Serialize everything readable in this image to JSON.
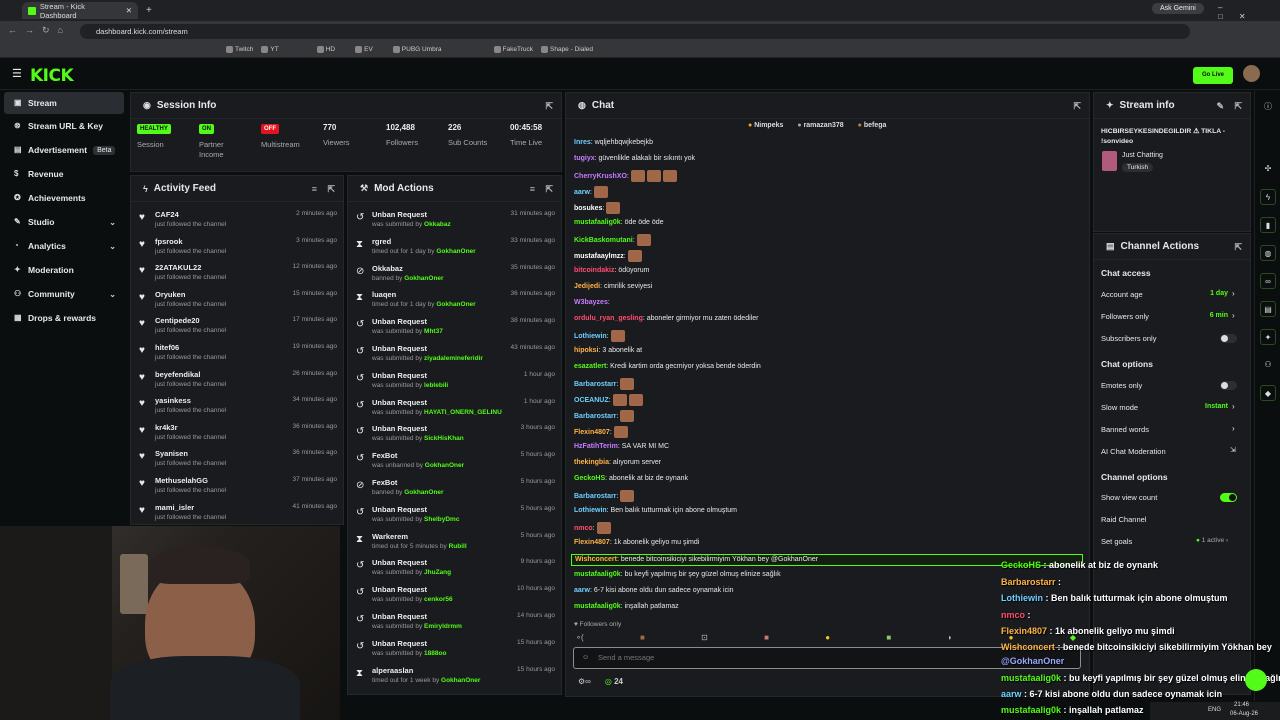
{
  "browser": {
    "tab_title": "Stream - Kick Dashboard",
    "url": "dashboard.kick.com/stream",
    "ask_gemini": "Ask Gemini",
    "bookmarks": [
      "Twitch",
      "YT",
      "HD",
      "EV",
      "PUBG Umbra",
      "FakeTruck",
      "Shape - Dialed"
    ]
  },
  "header": {
    "logo": "KICK",
    "go_live": "Go Live"
  },
  "sidebar": {
    "items": [
      {
        "label": "Stream",
        "icon": "video-icon"
      },
      {
        "label": "Stream URL & Key",
        "icon": "key-icon"
      },
      {
        "label": "Advertisement",
        "badge": "Beta",
        "icon": "megaphone-icon"
      },
      {
        "label": "Revenue",
        "icon": "dollar-icon"
      },
      {
        "label": "Achievements",
        "icon": "trophy-icon"
      },
      {
        "label": "Studio",
        "icon": "studio-icon"
      },
      {
        "label": "Analytics",
        "icon": "chart-icon"
      },
      {
        "label": "Moderation",
        "icon": "wrench-icon"
      },
      {
        "label": "Community",
        "icon": "people-icon"
      },
      {
        "label": "Drops & rewards",
        "icon": "gift-icon"
      }
    ]
  },
  "session": {
    "title": "Session Info",
    "stats": [
      {
        "value": "HEALTHY",
        "label": "Session",
        "kind": "badge-green"
      },
      {
        "value": "ON",
        "label": "Partner Income",
        "kind": "badge-green"
      },
      {
        "value": "OFF",
        "label": "Multistream",
        "kind": "badge-red"
      },
      {
        "value": "770",
        "label": "Viewers",
        "kind": "num"
      },
      {
        "value": "102,488",
        "label": "Followers",
        "kind": "num"
      },
      {
        "value": "226",
        "label": "Sub Counts",
        "kind": "num"
      },
      {
        "value": "00:45:58",
        "label": "Time Live",
        "kind": "num"
      }
    ]
  },
  "activity": {
    "title": "Activity Feed",
    "items": [
      {
        "name": "CAF24",
        "sub": "just followed the channel",
        "time": "2 minutes ago"
      },
      {
        "name": "fpsrook",
        "sub": "just followed the channel",
        "time": "3 minutes ago"
      },
      {
        "name": "22ATAKUL22",
        "sub": "just followed the channel",
        "time": "12 minutes ago"
      },
      {
        "name": "Oryuken",
        "sub": "just followed the channel",
        "time": "15 minutes ago"
      },
      {
        "name": "Centipede20",
        "sub": "just followed the channel",
        "time": "17 minutes ago"
      },
      {
        "name": "hitef06",
        "sub": "just followed the channel",
        "time": "19 minutes ago"
      },
      {
        "name": "beyefendikal",
        "sub": "just followed the channel",
        "time": "26 minutes ago"
      },
      {
        "name": "yasinkess",
        "sub": "just followed the channel",
        "time": "34 minutes ago"
      },
      {
        "name": "kr4k3r",
        "sub": "just followed the channel",
        "time": "36 minutes ago"
      },
      {
        "name": "Syanisen",
        "sub": "just followed the channel",
        "time": "36 minutes ago"
      },
      {
        "name": "MethuselahGG",
        "sub": "just followed the channel",
        "time": "37 minutes ago"
      },
      {
        "name": "mami_isler",
        "sub": "just followed the channel",
        "time": "41 minutes ago"
      }
    ]
  },
  "mod": {
    "title": "Mod Actions",
    "items": [
      {
        "name": "Unban Request",
        "sub": "was submitted by",
        "by": "Okkabaz",
        "time": "31 minutes ago",
        "icon": "undo-icon"
      },
      {
        "name": "rgred",
        "sub": "timed out for 1 day by",
        "by": "GokhanOner",
        "time": "33 minutes ago",
        "icon": "hourglass-icon"
      },
      {
        "name": "Okkabaz",
        "sub": "banned by",
        "by": "GokhanOner",
        "time": "35 minutes ago",
        "icon": "ban-icon"
      },
      {
        "name": "luaqen",
        "sub": "timed out for 1 day by",
        "by": "GokhanOner",
        "time": "36 minutes ago",
        "icon": "hourglass-icon"
      },
      {
        "name": "Unban Request",
        "sub": "was submitted by",
        "by": "Mht37",
        "time": "38 minutes ago",
        "icon": "undo-icon"
      },
      {
        "name": "Unban Request",
        "sub": "was submitted by",
        "by": "ziyadalemineferidir",
        "time": "43 minutes ago",
        "icon": "undo-icon"
      },
      {
        "name": "Unban Request",
        "sub": "was submitted by",
        "by": "leblebili",
        "time": "1 hour ago",
        "icon": "undo-icon"
      },
      {
        "name": "Unban Request",
        "sub": "was submitted by",
        "by": "HAYATI_ONERN_GELINU",
        "time": "1 hour ago",
        "icon": "undo-icon"
      },
      {
        "name": "Unban Request",
        "sub": "was submitted by",
        "by": "SickHisKhan",
        "time": "3 hours ago",
        "icon": "undo-icon"
      },
      {
        "name": "FexBot",
        "sub": "was unbanned by",
        "by": "GokhanOner",
        "time": "5 hours ago",
        "icon": "undo-icon"
      },
      {
        "name": "FexBot",
        "sub": "banned by",
        "by": "GokhanOner",
        "time": "5 hours ago",
        "icon": "ban-icon"
      },
      {
        "name": "Unban Request",
        "sub": "was submitted by",
        "by": "ShelbyDmc",
        "time": "5 hours ago",
        "icon": "undo-icon"
      },
      {
        "name": "Warkerem",
        "sub": "timed out for 5 minutes by",
        "by": "Rubill",
        "time": "5 hours ago",
        "icon": "hourglass-icon"
      },
      {
        "name": "Unban Request",
        "sub": "was submitted by",
        "by": "JhuZang",
        "time": "9 hours ago",
        "icon": "undo-icon"
      },
      {
        "name": "Unban Request",
        "sub": "was submitted by",
        "by": "cenkor56",
        "time": "10 hours ago",
        "icon": "undo-icon"
      },
      {
        "name": "Unban Request",
        "sub": "was submitted by",
        "by": "Emiryldrmm",
        "time": "14 hours ago",
        "icon": "undo-icon"
      },
      {
        "name": "Unban Request",
        "sub": "was submitted by",
        "by": "1888oo",
        "time": "15 hours ago",
        "icon": "undo-icon"
      },
      {
        "name": "alperaaslan",
        "sub": "timed out for 1 week by",
        "by": "GokhanOner",
        "time": "15 hours ago",
        "icon": "hourglass-icon"
      }
    ]
  },
  "chat": {
    "title": "Chat",
    "pinned": [
      "Nimpeks",
      "ramazan378",
      "befega"
    ],
    "messages": [
      {
        "user": "Inres",
        "text": ": wqljehbqwjkebejkb",
        "color": "#6fd0ff",
        "emotes": 0
      },
      {
        "user": "tugiyx",
        "text": ": güvenlikle alakalı bir sıkıntı yok",
        "color": "#c77dff",
        "emotes": 0
      },
      {
        "user": "CherryKrushXO",
        "text": ":",
        "color": "#c77dff",
        "emotes": 3
      },
      {
        "user": "aarw",
        "text": ":",
        "color": "#6fd0ff",
        "emotes": 1
      },
      {
        "user": "bosukes",
        "text": ":",
        "color": "#ffffff",
        "emotes": 1
      },
      {
        "user": "mustafaalig0k",
        "text": ": öde öde öde",
        "color": "#53fc18",
        "emotes": 0
      },
      {
        "user": "KickBaskomutani",
        "text": ":",
        "color": "#53fc18",
        "emotes": 1
      },
      {
        "user": "mustafaaylmzz",
        "text": ":",
        "color": "#ffffff",
        "emotes": 1
      },
      {
        "user": "bitcoindakiz",
        "text": ": ödüyorum",
        "color": "#ff4d6d",
        "emotes": 0
      },
      {
        "user": "Jedijedi",
        "text": ": cimrilik seviyesi",
        "color": "#ffb347",
        "emotes": 0
      },
      {
        "user": "W3bayzes",
        "text": ":",
        "color": "#c77dff",
        "emotes": 0
      },
      {
        "user": "ordulu_ryan_gesling",
        "text": ": aboneler girmiyor mu zaten ödediler",
        "color": "#ff4d6d",
        "emotes": 0
      },
      {
        "user": "Lothiewin",
        "text": ":",
        "color": "#6fd0ff",
        "emotes": 1
      },
      {
        "user": "hipoksi",
        "text": ": 3 abonelik at",
        "color": "#ffb347",
        "emotes": 0
      },
      {
        "user": "esazatlert",
        "text": ": Kredi kartim orda gecmiyor yoksa bende öderdin",
        "color": "#53fc18",
        "emotes": 0
      },
      {
        "user": "Barbarostarr",
        "text": ":",
        "color": "#6fd0ff",
        "emotes": 1
      },
      {
        "user": "OCEANUZ",
        "text": ":",
        "color": "#6fd0ff",
        "emotes": 2
      },
      {
        "user": "Barbarostarr",
        "text": ":",
        "color": "#6fd0ff",
        "emotes": 1
      },
      {
        "user": "Flexin4807",
        "text": ":",
        "color": "#ffb347",
        "emotes": 1
      },
      {
        "user": "HzFatihTerim",
        "text": ": SA VAR MI MC",
        "color": "#c77dff",
        "emotes": 0
      },
      {
        "user": "thekingbia",
        "text": ": alıyorum server",
        "color": "#ffb347",
        "emotes": 0
      },
      {
        "user": "GeckoHS",
        "text": ": abonelik at biz de oynank",
        "color": "#53fc18",
        "emotes": 0
      },
      {
        "user": "Barbarostarr",
        "text": ":",
        "color": "#6fd0ff",
        "emotes": 1
      },
      {
        "user": "Lothiewin",
        "text": ": Ben balık tutturmak için abone olmuştum",
        "color": "#6fd0ff",
        "emotes": 0
      },
      {
        "user": "nmco",
        "text": ":",
        "color": "#ff4d6d",
        "emotes": 1
      },
      {
        "user": "Flexin4807",
        "text": ": 1k abonelik geliyo mu şimdi",
        "color": "#ffb347",
        "emotes": 0
      },
      {
        "user": "Wishconcert",
        "text": ": benede bitcoinsikiciyi sikebilirmiyim Yökhan bey @GokhanOner",
        "color": "#ffb347",
        "emotes": 0,
        "highlight": true
      },
      {
        "user": "mustafaalig0k",
        "text": ": bu keyfi yapılmış bir şey güzel olmuş elinize sağlık",
        "color": "#53fc18",
        "emotes": 0
      },
      {
        "user": "aarw",
        "text": ": 6-7 kisi abone oldu dun sadece oynamak icin",
        "color": "#6fd0ff",
        "emotes": 0
      },
      {
        "user": "mustafaalig0k",
        "text": ": inşallah patlamaz",
        "color": "#53fc18",
        "emotes": 0
      }
    ],
    "followers_only": "Followers only",
    "placeholder": "Send a message",
    "viewer_count": "24"
  },
  "stream_info": {
    "title": "Stream info",
    "stream_title": "HICBIRSEYKESINDEGILDIR ⚠ TIKLA - !sonvideo",
    "category": "Just Chatting",
    "tag": "Turkish"
  },
  "channel_actions": {
    "title": "Channel Actions",
    "chat_access": "Chat access",
    "account_age": "Account age",
    "account_age_val": "1 day",
    "followers_only": "Followers only",
    "followers_only_val": "6 min",
    "subscribers_only": "Subscribers only",
    "chat_options": "Chat options",
    "emotes_only": "Emotes only",
    "slow_mode": "Slow mode",
    "slow_mode_val": "Instant",
    "banned_words": "Banned words",
    "ai_mod": "AI Chat Moderation",
    "channel_options": "Channel options",
    "show_view_count": "Show view count",
    "raid_channel": "Raid Channel",
    "set_goals": "Set goals",
    "set_goals_val": "1 active"
  },
  "overlay": [
    {
      "user": "GeckoHS",
      "text": " : abonelik at biz de oynank",
      "color": "#53fc18"
    },
    {
      "user": "Barbarostarr",
      "text": " :",
      "color": "#ffb347"
    },
    {
      "user": "Lothiewin",
      "text": " : Ben balık tutturmak için abone olmuştum",
      "color": "#6fd0ff"
    },
    {
      "user": "nmco",
      "text": " :",
      "color": "#ff4d6d"
    },
    {
      "user": "Flexin4807",
      "text": " : 1k abonelik geliyo mu şimdi",
      "color": "#ffb347"
    },
    {
      "user": "Wishconcert",
      "text": " : benede bitcoinsikiciyi sikebilirmiyim Yökhan bey",
      "color": "#ffb347"
    },
    {
      "user": "@GokhanOner",
      "text": "",
      "color": "#9aa7ff"
    },
    {
      "user": "mustafaalig0k",
      "text": " : bu keyfi yapılmış bir şey güzel olmuş elinize sağlık",
      "color": "#53fc18"
    },
    {
      "user": "aarw",
      "text": " : 6-7 kisi abone oldu dun sadece oynamak icin",
      "color": "#6fd0ff"
    },
    {
      "user": "mustafaalig0k",
      "text": " : inşallah patlamaz",
      "color": "#53fc18"
    }
  ],
  "taskbar": {
    "lang": "ENG",
    "time": "21:46",
    "date": "06-Aug-26"
  }
}
